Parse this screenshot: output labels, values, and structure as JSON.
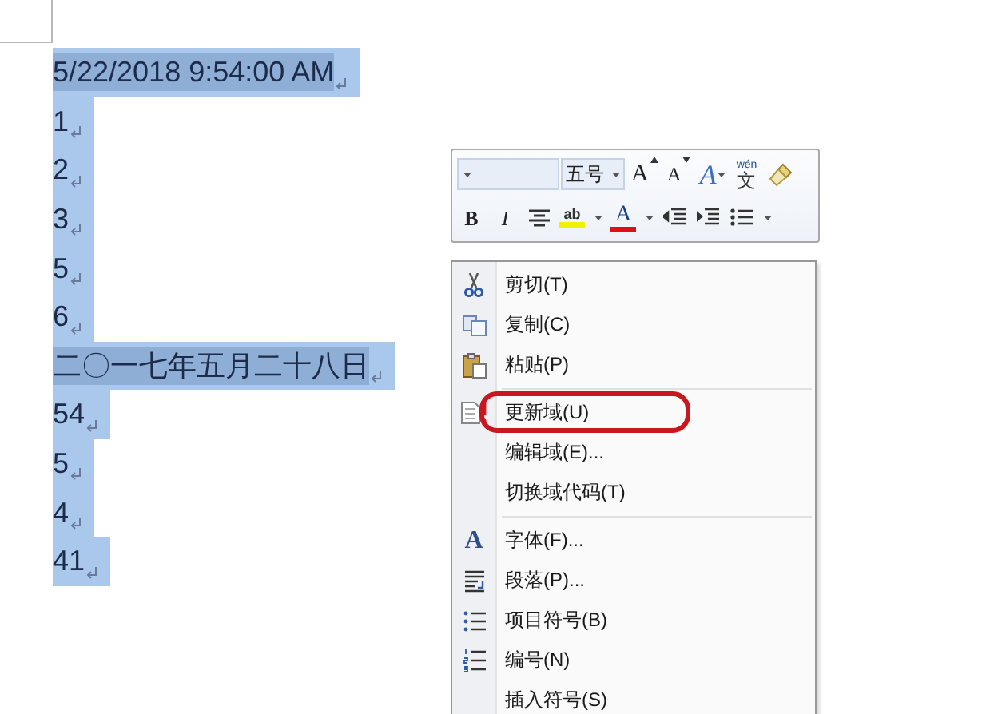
{
  "document": {
    "lines": [
      {
        "text": "5/22/2018 9:54:00 AM",
        "field": true
      },
      {
        "text": "1",
        "field": false
      },
      {
        "text": "2",
        "field": false
      },
      {
        "text": "3",
        "field": false
      },
      {
        "text": "5",
        "field": false
      },
      {
        "text": "6",
        "field": false
      },
      {
        "text": "二〇一七年五月二十八日",
        "field": true
      },
      {
        "text": "54",
        "field": false
      },
      {
        "text": "5",
        "field": false
      },
      {
        "text": "4",
        "field": false
      },
      {
        "text": "41",
        "field": false
      }
    ]
  },
  "mini_toolbar": {
    "font_size": "五号",
    "row_1": [
      {
        "kind": "grow-font",
        "glyph": "A"
      },
      {
        "kind": "shrink-font",
        "glyph": "A"
      },
      {
        "kind": "styles",
        "glyph": "A"
      },
      {
        "kind": "phonetic",
        "glyph": "文",
        "ruby": "wén"
      },
      {
        "kind": "format-painter"
      }
    ],
    "row_2": [
      {
        "kind": "bold",
        "glyph": "B"
      },
      {
        "kind": "italic",
        "glyph": "I"
      },
      {
        "kind": "center"
      },
      {
        "kind": "highlight",
        "glyph": "ab"
      },
      {
        "kind": "dropdown"
      },
      {
        "kind": "font-color",
        "glyph": "A"
      },
      {
        "kind": "dropdown"
      },
      {
        "kind": "outdent"
      },
      {
        "kind": "indent"
      },
      {
        "kind": "bullets"
      },
      {
        "kind": "dropdown"
      }
    ]
  },
  "context_menu": {
    "items": [
      {
        "kind": "cut",
        "label": "剪切(T)",
        "circled": false
      },
      {
        "kind": "copy",
        "label": "复制(C)",
        "circled": false
      },
      {
        "kind": "paste",
        "label": "粘贴(P)",
        "circled": false
      },
      {
        "kind": "separator"
      },
      {
        "kind": "update",
        "label": "更新域(U)",
        "circled": true
      },
      {
        "kind": "plain",
        "label": "编辑域(E)...",
        "circled": false
      },
      {
        "kind": "plain",
        "label": "切换域代码(T)",
        "circled": false
      },
      {
        "kind": "separator"
      },
      {
        "kind": "font",
        "label": "字体(F)...",
        "icon_text": "A",
        "circled": false
      },
      {
        "kind": "paragraph",
        "label": "段落(P)...",
        "circled": false
      },
      {
        "kind": "bullets",
        "label": "项目符号(B)",
        "circled": false
      },
      {
        "kind": "numbering",
        "label": "编号(N)",
        "circled": false
      },
      {
        "kind": "plain",
        "label": "插入符号(S)",
        "circled": false
      }
    ]
  }
}
